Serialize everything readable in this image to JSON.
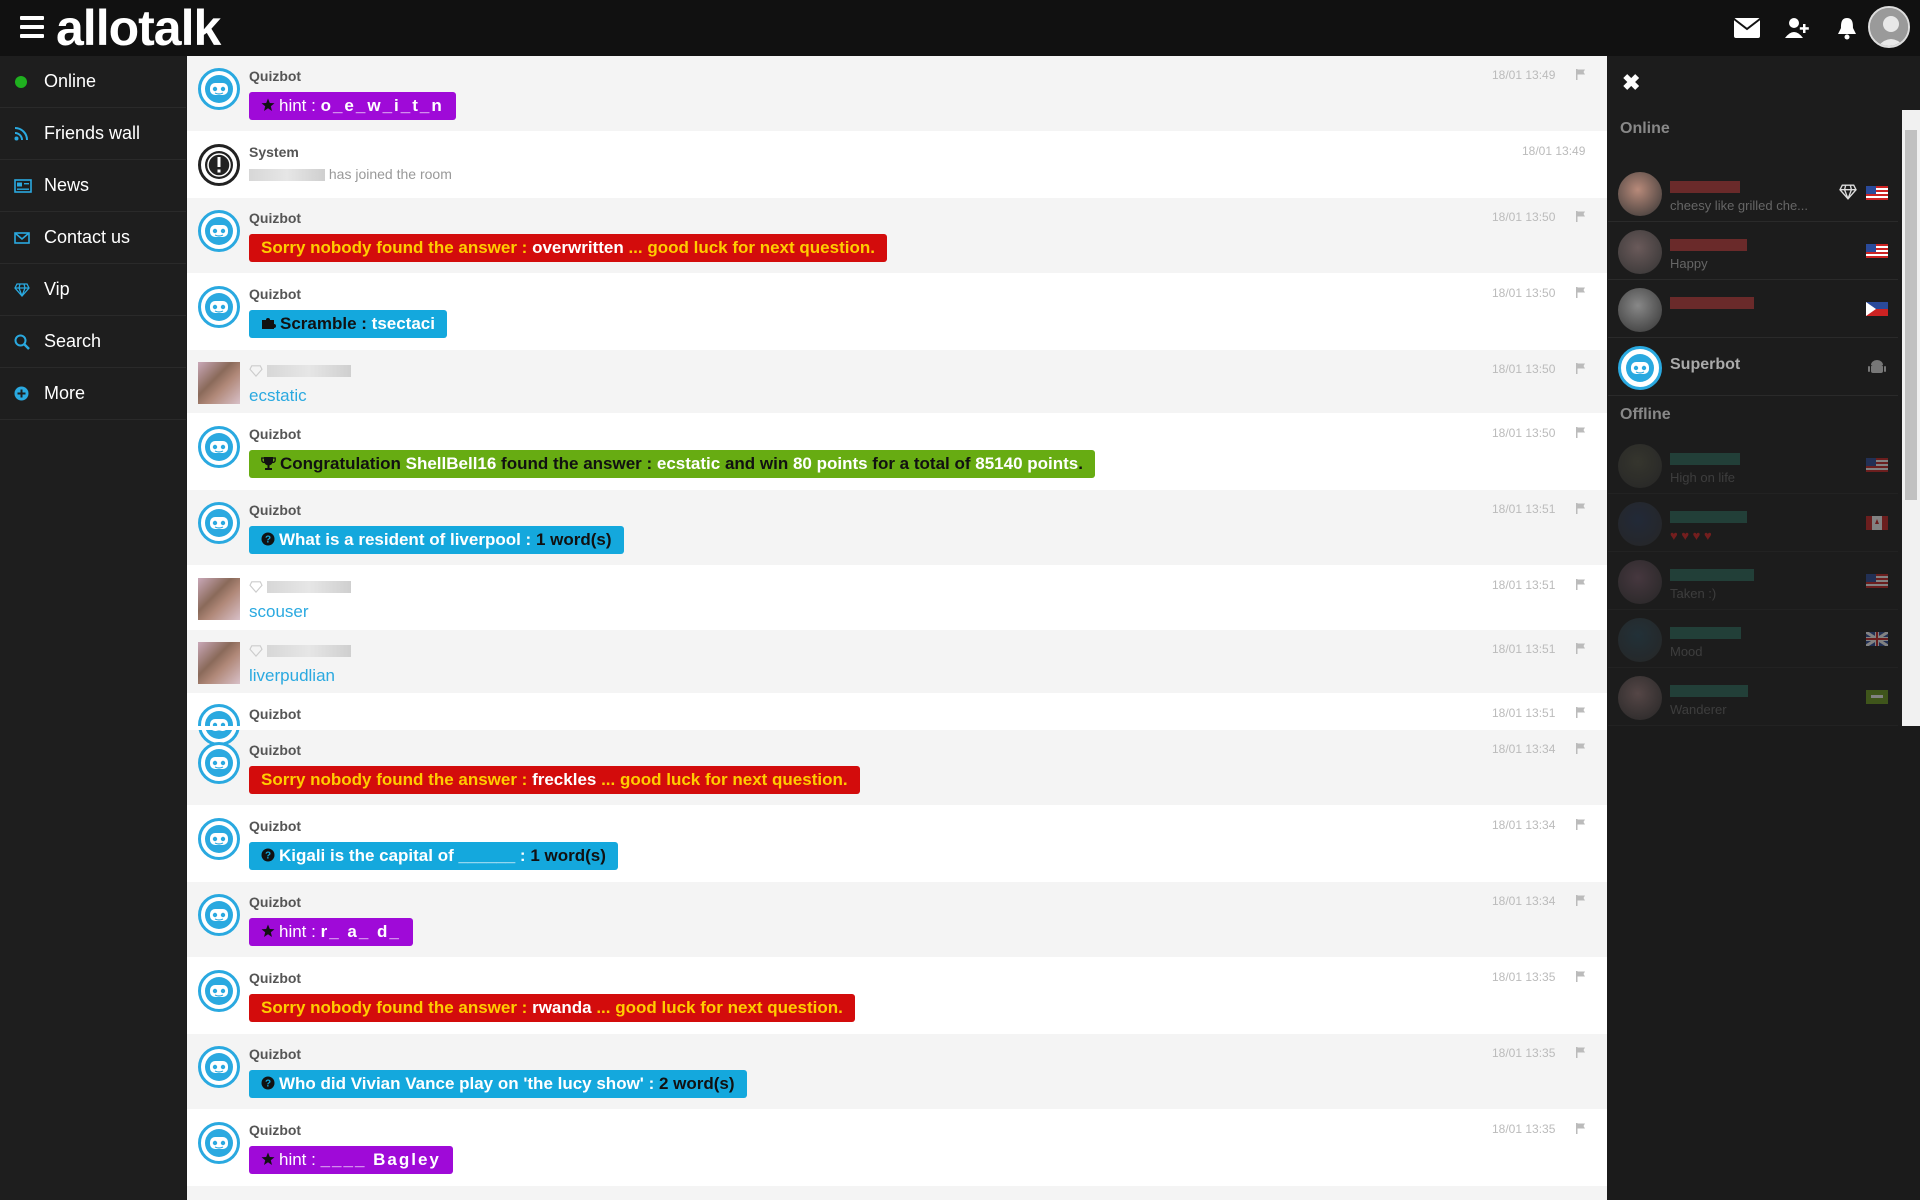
{
  "topbar": {
    "logo": "allotalk",
    "icons": [
      "envelope-icon",
      "add-friend-icon",
      "bell-icon",
      "avatar"
    ]
  },
  "sidebar": {
    "items": [
      {
        "label": "Online",
        "icon": "online-dot-icon"
      },
      {
        "label": "Friends wall",
        "icon": "rss-icon"
      },
      {
        "label": "News",
        "icon": "newspaper-icon"
      },
      {
        "label": "Contact us",
        "icon": "envelope-icon"
      },
      {
        "label": "Vip",
        "icon": "diamond-icon"
      },
      {
        "label": "Search",
        "icon": "search-icon"
      },
      {
        "label": "More",
        "icon": "plus-circle-icon"
      }
    ]
  },
  "colors": {
    "accent": "#2aa9e0",
    "hint": "#9f0ad8",
    "fail": "#d30c0c",
    "question": "#14a8dd",
    "win": "#67ac12"
  },
  "chat": {
    "top": [
      {
        "name": "Quizbot",
        "time": "18/01 13:49",
        "kind": "hint",
        "prefix": "hint : ",
        "value": "o_e_w_i_t_n"
      },
      {
        "name": "System",
        "time": "18/01 13:49",
        "kind": "system",
        "text": "has joined the room"
      },
      {
        "name": "Quizbot",
        "time": "18/01 13:50",
        "kind": "fail",
        "a": "Sorry nobody found the answer : ",
        "b": "overwritten",
        "c": " ... good luck for next question."
      },
      {
        "name": "Quizbot",
        "time": "18/01 13:50",
        "kind": "scramble",
        "a": "Scramble : ",
        "b": "tsectaci"
      },
      {
        "name": "",
        "time": "18/01 13:50",
        "kind": "user",
        "text": "ecstatic"
      },
      {
        "name": "Quizbot",
        "time": "18/01 13:50",
        "kind": "win",
        "parts": [
          "Congratulation ",
          "ShellBell16",
          " found the answer : ",
          "ecstatic",
          " and win ",
          "80 points",
          " for a total of ",
          "85140 points",
          "."
        ]
      },
      {
        "name": "Quizbot",
        "time": "18/01 13:51",
        "kind": "question",
        "a": "What is a resident of liverpool : ",
        "b": "1 word(s)"
      },
      {
        "name": "",
        "time": "18/01 13:51",
        "kind": "user",
        "text": "scouser"
      },
      {
        "name": "",
        "time": "18/01 13:51",
        "kind": "user",
        "text": "liverpudlian"
      },
      {
        "name": "Quizbot",
        "time": "18/01 13:51",
        "kind": "cut"
      }
    ],
    "bottom": [
      {
        "name": "Quizbot",
        "time": "18/01 13:34",
        "kind": "fail",
        "a": "Sorry nobody found the answer : ",
        "b": "freckles",
        "c": " ... good luck for next question."
      },
      {
        "name": "Quizbot",
        "time": "18/01 13:34",
        "kind": "question",
        "a": "Kigali is the capital of ______ : ",
        "b": "1 word(s)"
      },
      {
        "name": "Quizbot",
        "time": "18/01 13:34",
        "kind": "hint",
        "prefix": "hint : ",
        "value": "r_ a_ d_"
      },
      {
        "name": "Quizbot",
        "time": "18/01 13:35",
        "kind": "fail",
        "a": "Sorry nobody found the answer : ",
        "b": "rwanda",
        "c": " ... good luck for next question."
      },
      {
        "name": "Quizbot",
        "time": "18/01 13:35",
        "kind": "question",
        "a": "Who did Vivian Vance play on 'the lucy show' : ",
        "b": "2 word(s)"
      },
      {
        "name": "Quizbot",
        "time": "18/01 13:35",
        "kind": "hint",
        "prefix": "hint : ",
        "value": "____ Bagley"
      }
    ]
  },
  "userlist": {
    "online_label": "Online",
    "offline_label": "Offline",
    "online": [
      {
        "name": "",
        "status": "cheesy like grilled che...",
        "flag": "us",
        "badge": "diamond"
      },
      {
        "name": "",
        "status": "Happy",
        "flag": "us"
      },
      {
        "name": "",
        "status": "",
        "flag": "ph"
      },
      {
        "name": "Superbot",
        "status": "",
        "flag": "android"
      }
    ],
    "offline": [
      {
        "name": "",
        "status": "High on life",
        "flag": "us"
      },
      {
        "name": "",
        "status": "♥ ♥ ♥ ♥",
        "flag": "ca"
      },
      {
        "name": "",
        "status": "Taken :)",
        "flag": "us"
      },
      {
        "name": "",
        "status": "Mood",
        "flag": "gb"
      },
      {
        "name": "",
        "status": "Wanderer",
        "flag": "other"
      }
    ]
  }
}
